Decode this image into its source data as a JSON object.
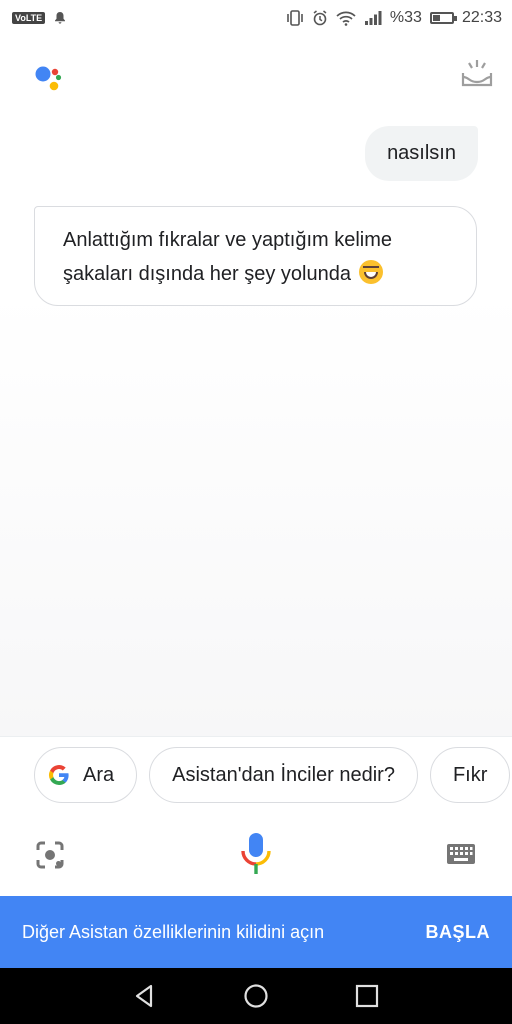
{
  "status_bar": {
    "volte": "VoLTE",
    "battery_percent": "%33",
    "time": "22:33",
    "icons": [
      "notification-bell-icon",
      "vibrate-icon",
      "alarm-icon",
      "wifi-icon",
      "signal-icon",
      "battery-icon"
    ]
  },
  "header": {
    "logo": "google-assistant-logo",
    "snapshot_icon": "snapshot-tray-icon"
  },
  "conversation": {
    "user_message": "nasılsın",
    "assistant_message_line1": "Anlattığım fıkralar ve yaptığım kelime",
    "assistant_message_line2": "şakaları dışında her şey yolunda",
    "assistant_emoji": "laughing-face-emoji"
  },
  "suggestions": [
    {
      "label": "Ara",
      "icon": "google-g-icon"
    },
    {
      "label": "Asistan'dan İnciler nedir?"
    },
    {
      "label": "Fıkr"
    }
  ],
  "input_bar": {
    "lens": "lens-icon",
    "mic": "microphone-icon",
    "keyboard": "keyboard-icon"
  },
  "banner": {
    "text": "Diğer Asistan özelliklerinin kilidini açın",
    "action": "BAŞLA",
    "color": "#4285f4"
  },
  "colors": {
    "blue": "#4285f4",
    "red": "#ea4335",
    "yellow": "#fbbc05",
    "green": "#34a853"
  }
}
